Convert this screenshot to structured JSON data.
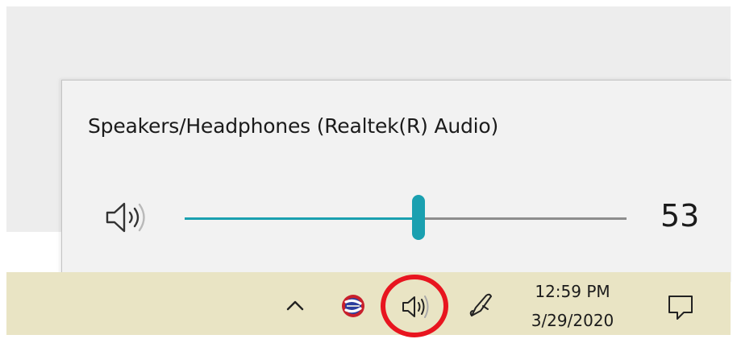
{
  "flyout": {
    "device_name": "Speakers/Headphones (Realtek(R) Audio)",
    "volume_value": "53",
    "volume_level": 0.53,
    "speaker_icon": "speaker-volume-icon"
  },
  "taskbar": {
    "clock_time": "12:59 PM",
    "clock_date": "3/29/2020",
    "icons": [
      "chevron-up-icon",
      "app-tray-icon",
      "speaker-volume-icon",
      "pen-icon",
      "action-center-icon"
    ]
  },
  "colors": {
    "accent": "#1aa0b0",
    "track": "#8d8d8d",
    "taskbar": "#e9e4c4",
    "flyout_bg": "#f2f2f2",
    "highlight": "#e8151f"
  }
}
